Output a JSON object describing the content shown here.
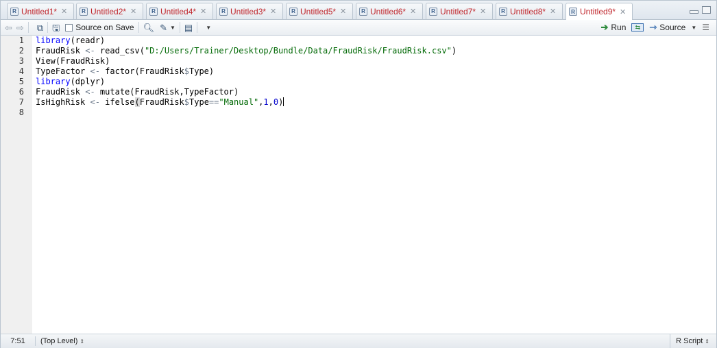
{
  "tabs": [
    {
      "label": "Untitled1*",
      "active": false
    },
    {
      "label": "Untitled2*",
      "active": false
    },
    {
      "label": "Untitled4*",
      "active": false
    },
    {
      "label": "Untitled3*",
      "active": false
    },
    {
      "label": "Untitled5*",
      "active": false
    },
    {
      "label": "Untitled6*",
      "active": false
    },
    {
      "label": "Untitled7*",
      "active": false
    },
    {
      "label": "Untitled8*",
      "active": false
    },
    {
      "label": "Untitled9*",
      "active": true
    }
  ],
  "toolbar": {
    "source_on_save": "Source on Save",
    "run": "Run",
    "source": "Source"
  },
  "editor": {
    "line_numbers": [
      "1",
      "2",
      "3",
      "4",
      "5",
      "6",
      "7",
      "8"
    ],
    "lines": [
      "library(readr)",
      "FraudRisk <- read_csv(\"D:/Users/Trainer/Desktop/Bundle/Data/FraudRisk/FraudRisk.csv\")",
      "View(FraudRisk)",
      "TypeFactor <- factor(FraudRisk$Type)",
      "library(dplyr)",
      "FraudRisk <- mutate(FraudRisk,TypeFactor)",
      "IsHighRisk <- ifelse(FraudRisk$Type==\"Manual\",1,0)",
      ""
    ]
  },
  "status": {
    "position": "7:51",
    "scope": "(Top Level)",
    "file_type": "R Script"
  },
  "colors": {
    "tab_label": "#c0272d",
    "keyword": "#0000ff",
    "string": "#036a07",
    "number": "#0000cd"
  }
}
